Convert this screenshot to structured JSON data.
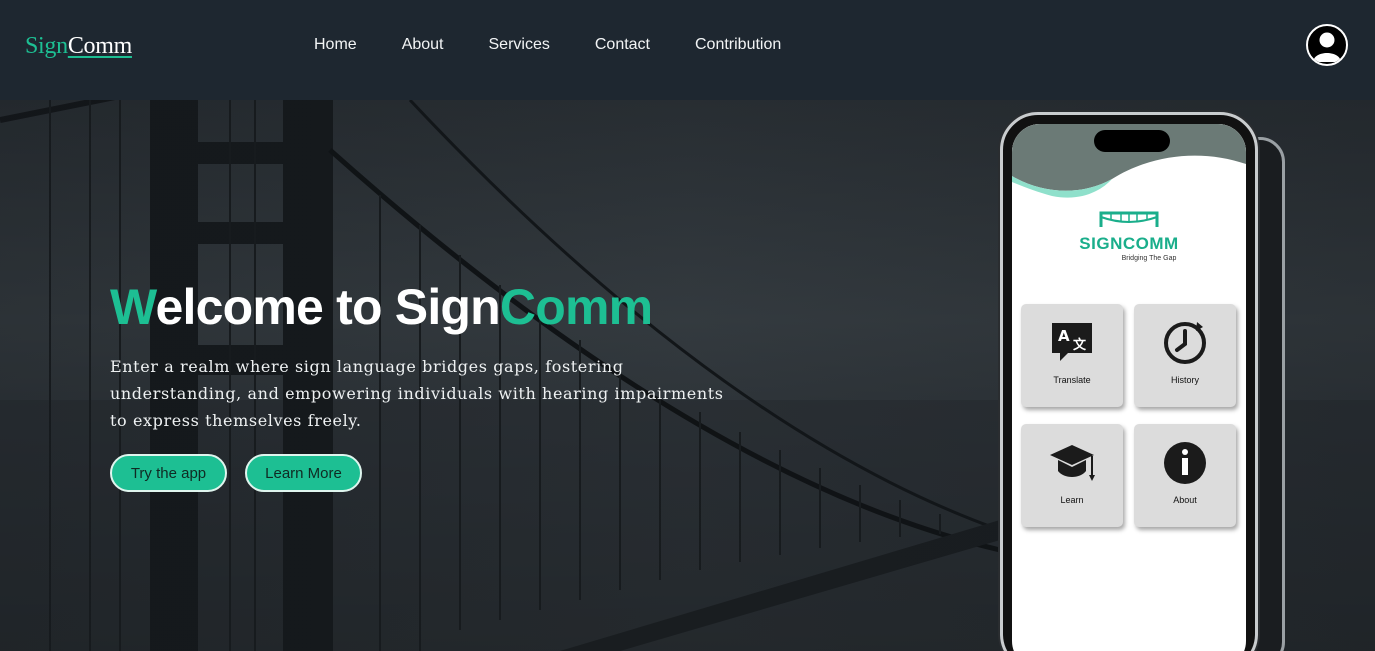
{
  "header": {
    "logo_part1": "Sign",
    "logo_part2": "Comm",
    "nav": [
      "Home",
      "About",
      "Services",
      "Contact",
      "Contribution"
    ]
  },
  "hero": {
    "title_accent1": "W",
    "title_mid": "elcome to Sign",
    "title_accent2": "Comm",
    "subtitle": "Enter a realm where sign language bridges gaps, fostering understanding, and empowering individuals with hearing impairments to express themselves freely.",
    "buttons": [
      "Try the app",
      "Learn More"
    ]
  },
  "phone": {
    "brand": "SIGNCOMM",
    "tagline": "Bridging The Gap",
    "tiles": [
      "Translate",
      "History",
      "Learn",
      "About"
    ]
  },
  "colors": {
    "accent": "#1dbf93",
    "header_bg": "#1e2730"
  },
  "icons": [
    "user-avatar-icon",
    "translate-icon",
    "history-icon",
    "graduation-cap-icon",
    "info-icon",
    "bridge-logo-icon"
  ]
}
